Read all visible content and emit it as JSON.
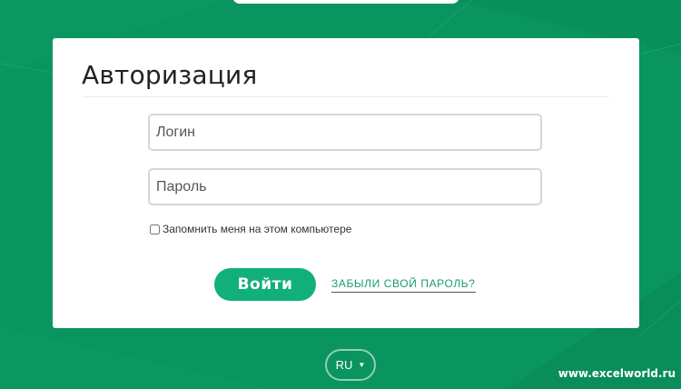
{
  "colors": {
    "background": "#0a9460",
    "card": "#ffffff",
    "accent": "#12b079",
    "link": "#1a9c6b"
  },
  "form": {
    "title": "Авторизация",
    "login_placeholder": "Логин",
    "login_value": "",
    "password_placeholder": "Пароль",
    "password_value": "",
    "remember_label": "Запомнить меня на этом компьютере",
    "remember_checked": false,
    "submit_label": "Войти",
    "forgot_label": "ЗАБЫЛИ СВОЙ ПАРОЛЬ?"
  },
  "language": {
    "selected": "RU",
    "icon": "chevron-down-icon"
  },
  "watermark": "www.excelworld.ru"
}
